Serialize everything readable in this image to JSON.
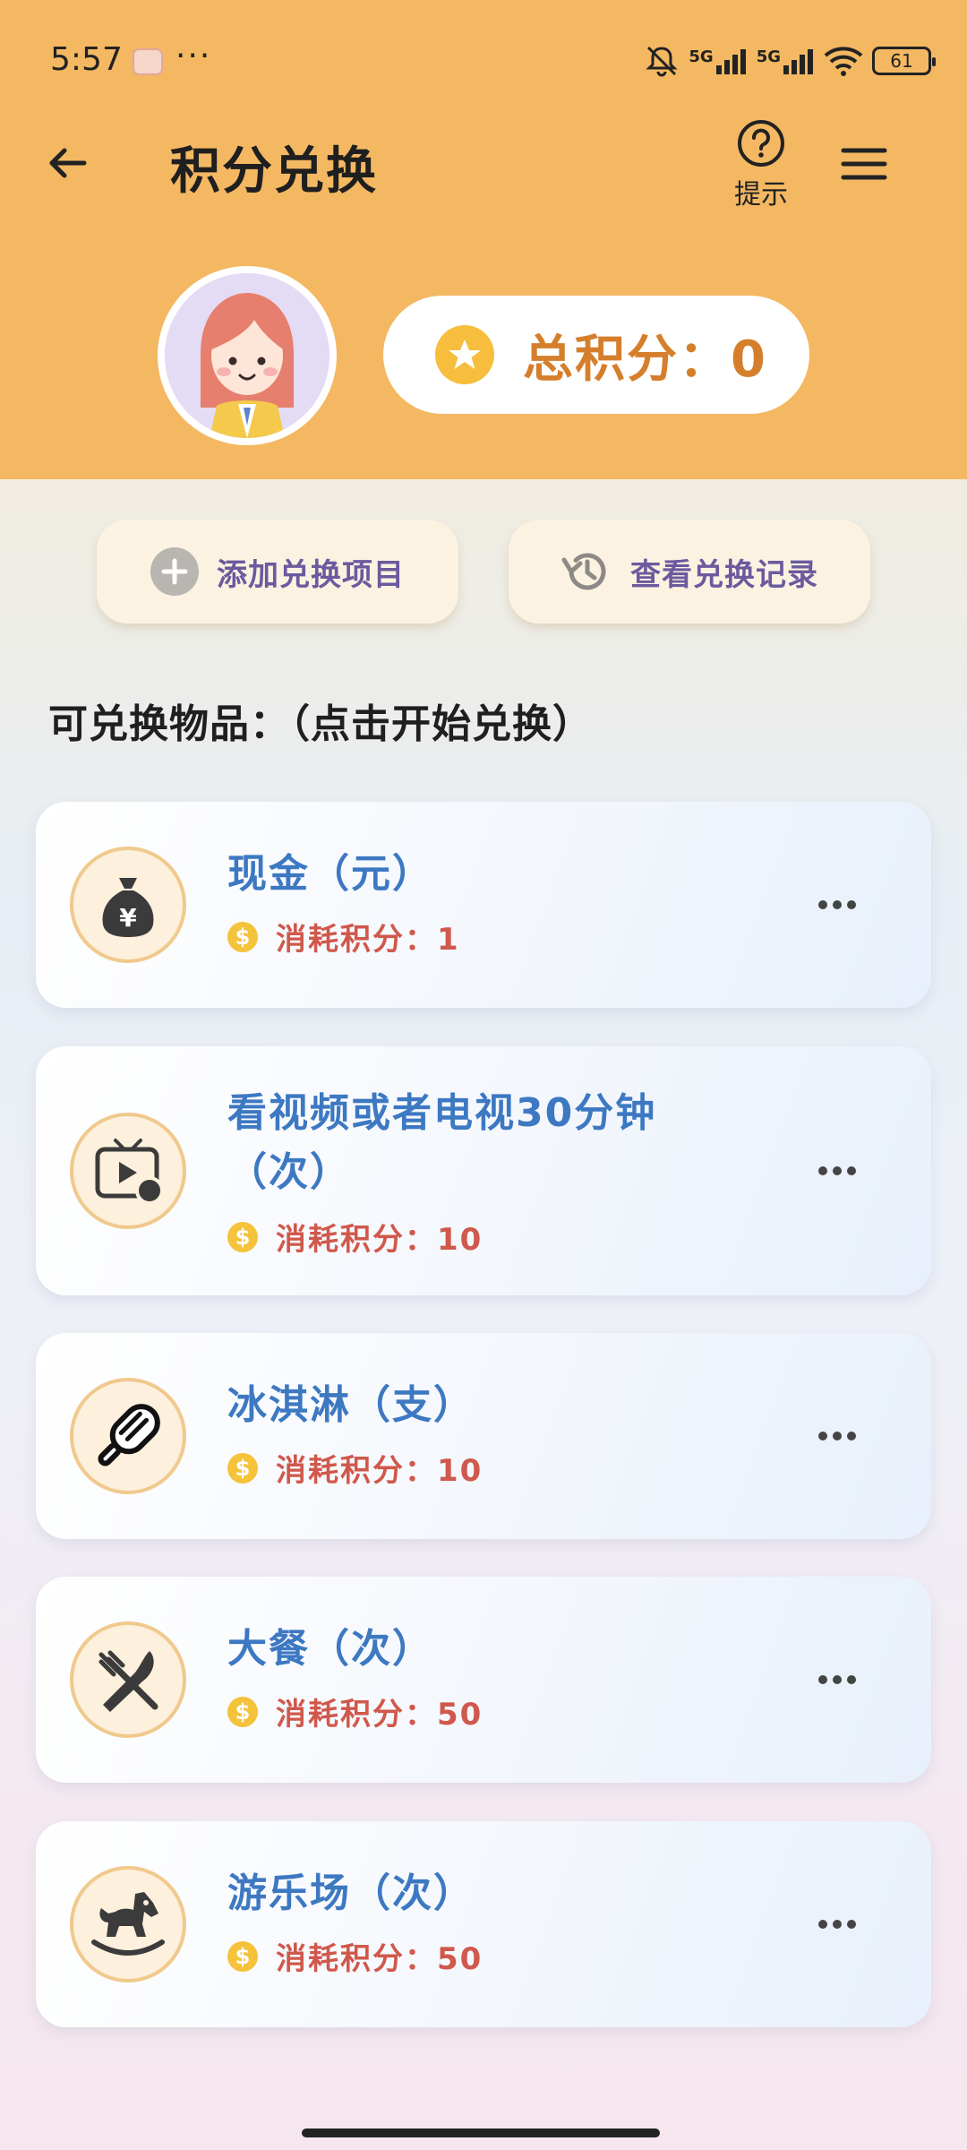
{
  "status_bar": {
    "time": "5:57",
    "dots": "···",
    "network_1": "5G",
    "network_2": "5G",
    "battery": "61"
  },
  "header": {
    "title": "积分兑换",
    "hint_label": "提示",
    "total_points_label": "总积分：0"
  },
  "actions": {
    "add_label": "添加兑换项目",
    "history_label": "查看兑换记录"
  },
  "section": {
    "title": "可兑换物品：（点击开始兑换）"
  },
  "items": [
    {
      "name": "现金（元）",
      "cost": "消耗积分：1",
      "icon": "money-bag-icon"
    },
    {
      "name_line1": "看视频或者电视30分钟",
      "name_line2": "（次）",
      "cost": "消耗积分：10",
      "icon": "tv-icon"
    },
    {
      "name": "冰淇淋（支）",
      "cost": "消耗积分：10",
      "icon": "popsicle-icon"
    },
    {
      "name": "大餐（次）",
      "cost": "消耗积分：50",
      "icon": "fork-knife-icon"
    },
    {
      "name": "游乐场（次）",
      "cost": "消耗积分：50",
      "icon": "rocking-horse-icon"
    }
  ],
  "colors": {
    "header_bg": "#f4b862",
    "title_blue": "#3d78c2",
    "cost_red": "#d0584c",
    "points_orange": "#d57f2c",
    "action_purple": "#6b5a9e"
  }
}
